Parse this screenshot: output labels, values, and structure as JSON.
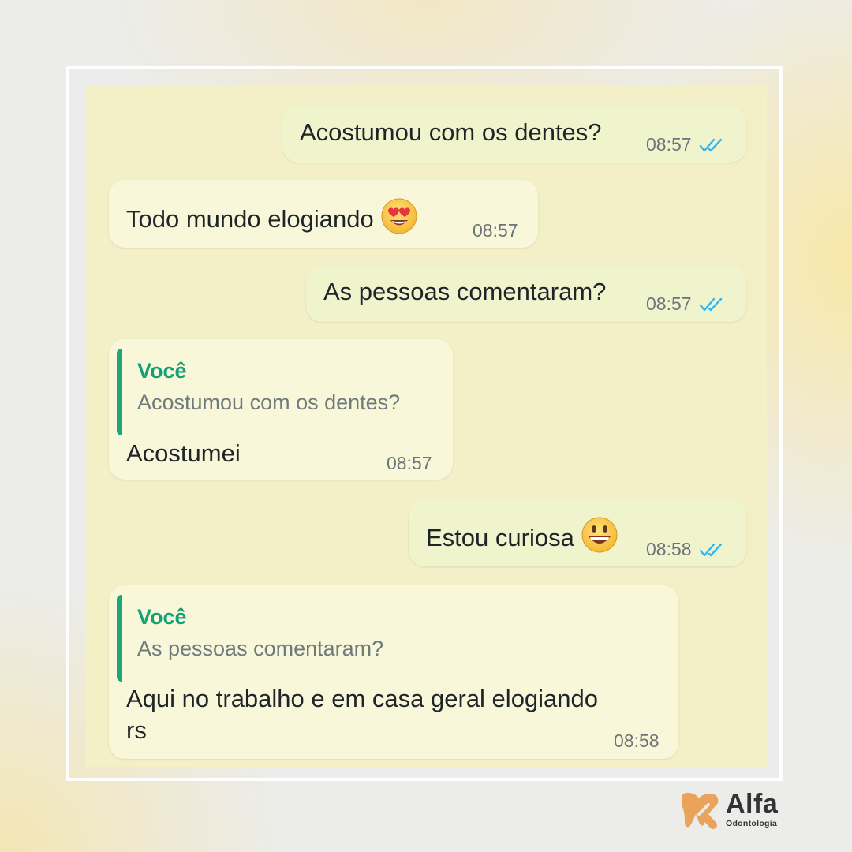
{
  "messages": [
    {
      "direction": "outgoing",
      "text": "Acostumou com os dentes?",
      "time": "08:57",
      "status_icon": "double-check-read-icon"
    },
    {
      "direction": "incoming",
      "text": "Todo mundo elogiando",
      "emoji": "heart-eyes-emoji",
      "time": "08:57"
    },
    {
      "direction": "outgoing",
      "text": "As pessoas comentaram?",
      "time": "08:57",
      "status_icon": "double-check-read-icon"
    },
    {
      "direction": "incoming",
      "quote": {
        "author": "Você",
        "text": "Acostumou com os dentes?"
      },
      "text": "Acostumei",
      "time": "08:57"
    },
    {
      "direction": "outgoing",
      "text": "Estou curiosa",
      "emoji": "grinning-face-emoji",
      "time": "08:58",
      "status_icon": "double-check-read-icon"
    },
    {
      "direction": "incoming",
      "quote": {
        "author": "Você",
        "text": "As pessoas comentaram?"
      },
      "text_lines": [
        "Aqui no trabalho e em casa geral elogiando",
        "rs"
      ],
      "time": "08:58"
    }
  ],
  "brand": {
    "name": "Alfa",
    "subtitle": "Odontologia",
    "logo_icon": "tooth-logo-icon"
  },
  "colors": {
    "chat_background": "#f3efc6",
    "incoming_bubble": "#f8f7d9",
    "outgoing_bubble": "#eff4cd",
    "quote_accent": "#1ea679",
    "read_ticks": "#34b7f1",
    "brand_orange": "#e9a35a"
  }
}
